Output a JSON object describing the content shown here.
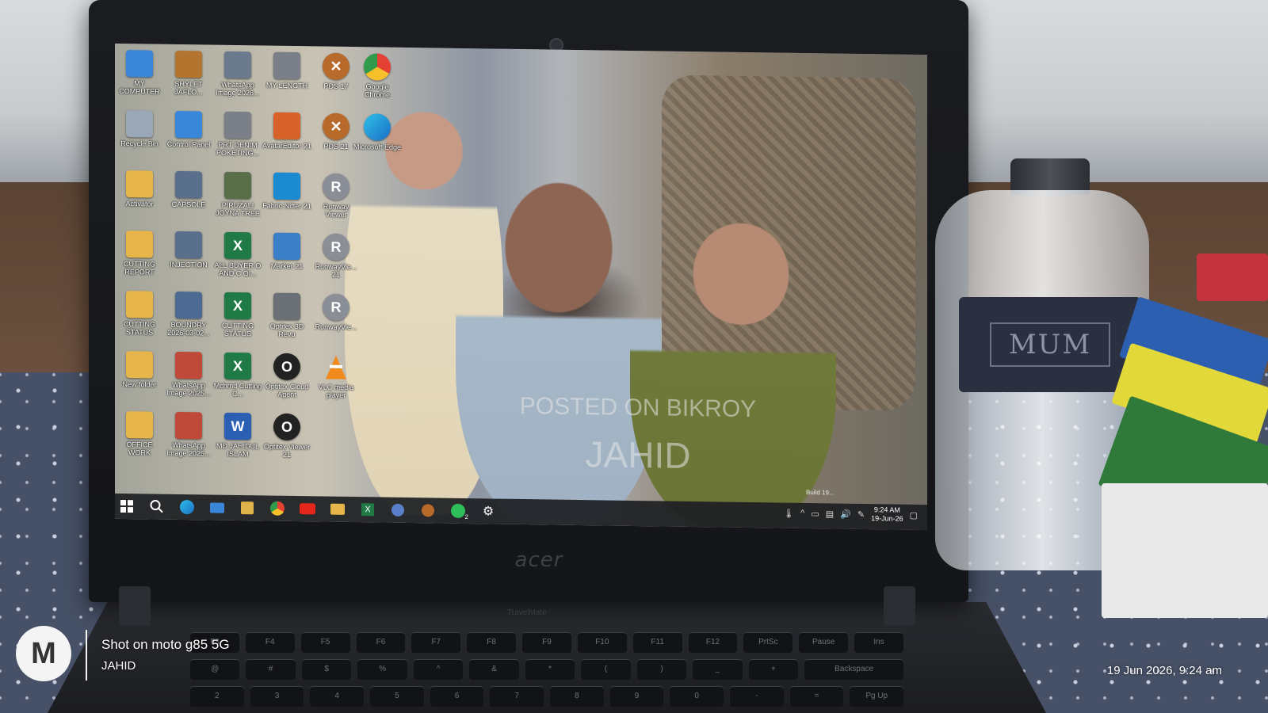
{
  "desktop": {
    "icons": [
      {
        "label": "MY COMPUTER",
        "icon": "monitor-icon",
        "color": "#3a86d8"
      },
      {
        "label": "Recycle Bin",
        "icon": "recycle-bin-icon",
        "color": "#9aa7b6"
      },
      {
        "label": "Activator",
        "icon": "folder-icon",
        "color": "#e7b64a"
      },
      {
        "label": "CUTTING REPORT",
        "icon": "folder-icon",
        "color": "#e7b64a"
      },
      {
        "label": "CUTTING STATUS",
        "icon": "folder-icon",
        "color": "#e7b64a"
      },
      {
        "label": "New folder",
        "icon": "folder-icon",
        "color": "#e7b64a"
      },
      {
        "label": "OFFICE WORK",
        "icon": "folder-icon",
        "color": "#e7b64a"
      },
      {
        "label": "SHYLET JAFLO...",
        "icon": "archive-icon",
        "color": "#b3742f"
      },
      {
        "label": "Control Panel",
        "icon": "control-panel-icon",
        "color": "#3a86d8"
      },
      {
        "label": "CAPSOLE",
        "icon": "document-icon",
        "color": "#5a6f8c"
      },
      {
        "label": "INJECTION",
        "icon": "document-icon",
        "color": "#5a6f8c"
      },
      {
        "label": "BOUNDRY 2026-03-02...",
        "icon": "image-icon",
        "color": "#4c6a92"
      },
      {
        "label": "WhatsApp Image 2025...",
        "icon": "image-icon",
        "color": "#c04a3a"
      },
      {
        "label": "WhatsApp Image 2025...",
        "icon": "image-icon",
        "color": "#c04a3a"
      },
      {
        "label": "WhatsApp Image 2026...",
        "icon": "image-icon",
        "color": "#6a7a8c"
      },
      {
        "label": "PRT DENIM POKETING...",
        "icon": "document-icon",
        "color": "#7a7f88"
      },
      {
        "label": "PIRUZALI JOYNA TREE",
        "icon": "image-icon",
        "color": "#5b6e4a"
      },
      {
        "label": "ALL BUYER O AND C OI...",
        "icon": "excel-icon",
        "color": "#1f7a45"
      },
      {
        "label": "CUTTING STATUS",
        "icon": "excel-icon",
        "color": "#1f7a45"
      },
      {
        "label": "Mchmd Cutting C...",
        "icon": "excel-icon",
        "color": "#1f7a45"
      },
      {
        "label": "MD JAHIDUL ISLAM",
        "icon": "word-icon",
        "color": "#2b5fb4"
      },
      {
        "label": "MY LENGTH",
        "icon": "document-icon",
        "color": "#7a7f88"
      },
      {
        "label": "AvatarEditor 21",
        "icon": "avatar-editor-icon",
        "color": "#d8632a"
      },
      {
        "label": "Fabric Nifter 21",
        "icon": "fabric-icon",
        "color": "#1c8ad0"
      },
      {
        "label": "Marker 21",
        "icon": "marker-icon",
        "color": "#3a7fc8"
      },
      {
        "label": "Optitex 3D Revu",
        "icon": "optitex-3d-icon",
        "color": "#6b6f76"
      },
      {
        "label": "Optitex Cloud Agent",
        "icon": "optitex-icon",
        "color": "#222222"
      },
      {
        "label": "Optitex Viewer 21",
        "icon": "optitex-icon",
        "color": "#222222"
      },
      {
        "label": "PDS 17",
        "icon": "pds-icon",
        "color": "#b86a2a"
      },
      {
        "label": "PDS 21",
        "icon": "pds-icon",
        "color": "#b86a2a"
      },
      {
        "label": "Runway Viewer",
        "icon": "runway-icon",
        "color": "#8a8f97"
      },
      {
        "label": "RunwayVie... 21",
        "icon": "runway-icon",
        "color": "#8a8f97"
      },
      {
        "label": "RunwayVie...",
        "icon": "runway-icon",
        "color": "#8a8f97"
      },
      {
        "label": "VLC media player",
        "icon": "vlc-icon",
        "color": "#f08a1c"
      },
      {
        "label": "Google Chrome",
        "icon": "chrome-icon",
        "color": "#2f9b4a"
      },
      {
        "label": "Microsoft Edge",
        "icon": "edge-icon",
        "color": "#1f86c9"
      }
    ]
  },
  "wallpaper": {
    "watermark_line1": "POSTED ON BIKROY",
    "watermark_line2": "JAHID",
    "build_text": "Build 19..."
  },
  "taskbar": {
    "icons": [
      "windows-start-icon",
      "search-icon",
      "edge-icon",
      "mail-icon",
      "store-icon",
      "chrome-icon",
      "youtube-icon",
      "file-explorer-icon",
      "excel-icon",
      "app-icon",
      "pds-icon",
      "whatsapp-icon",
      "settings-icon"
    ],
    "whatsapp_badge": "2",
    "clock_time": "9:24 AM",
    "clock_date": "19-Jun-26"
  },
  "laptop": {
    "brand": "acer",
    "keyboard_label": "TravelMate"
  },
  "bottle": {
    "label": "MUM"
  },
  "camera": {
    "shot_on": "Shot on moto g85 5G",
    "author": "JAHID",
    "timestamp": "19 Jun 2026, 9:24 am"
  }
}
